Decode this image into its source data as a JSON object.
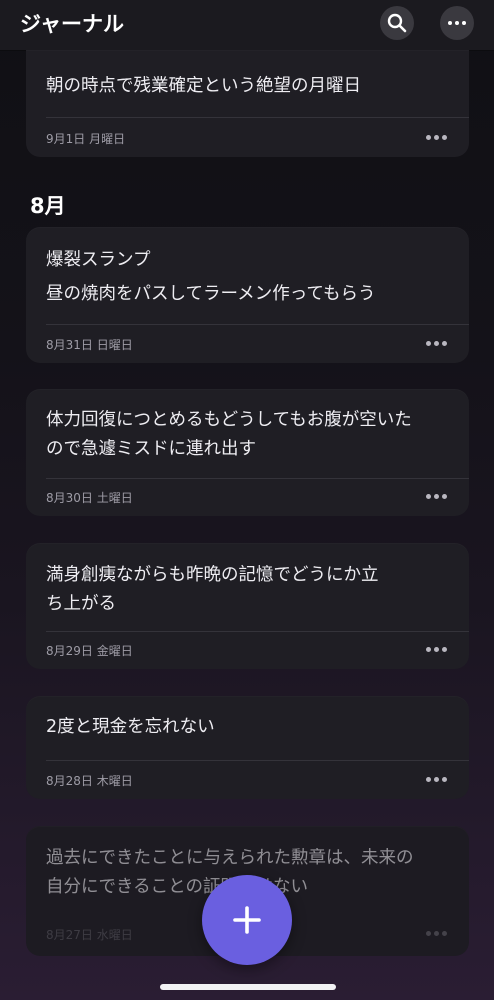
{
  "header": {
    "title": "ジャーナル",
    "search_icon": "search-icon",
    "more_icon": "more-horizontal-icon"
  },
  "month_heading": "8月",
  "entries": [
    {
      "lines": [
        "朝の時点で残業確定という絶望の月曜日"
      ],
      "date": "9月1日 月曜日"
    },
    {
      "lines": [
        "爆裂スランプ",
        "昼の焼肉をパスしてラーメン作ってもらう"
      ],
      "date": "8月31日 日曜日"
    },
    {
      "lines": [
        "体力回復につとめるもどうしてもお腹が空いた",
        "ので急遽ミスドに連れ出す"
      ],
      "date": "8月30日 土曜日"
    },
    {
      "lines": [
        "満身創痍ながらも昨晩の記憶でどうにか立",
        "ち上がる"
      ],
      "date": "8月29日 金曜日"
    },
    {
      "lines": [
        "2度と現金を忘れない"
      ],
      "date": "8月28日 木曜日"
    },
    {
      "lines": [
        "過去にできたことに与えられた勲章は、未来の",
        "自分にできることの証明ではない"
      ],
      "date": "8月27日 水曜日"
    }
  ],
  "fab_icon": "plus-icon",
  "colors": {
    "accent": "#6a5fe0",
    "card": "#1f1e24"
  }
}
